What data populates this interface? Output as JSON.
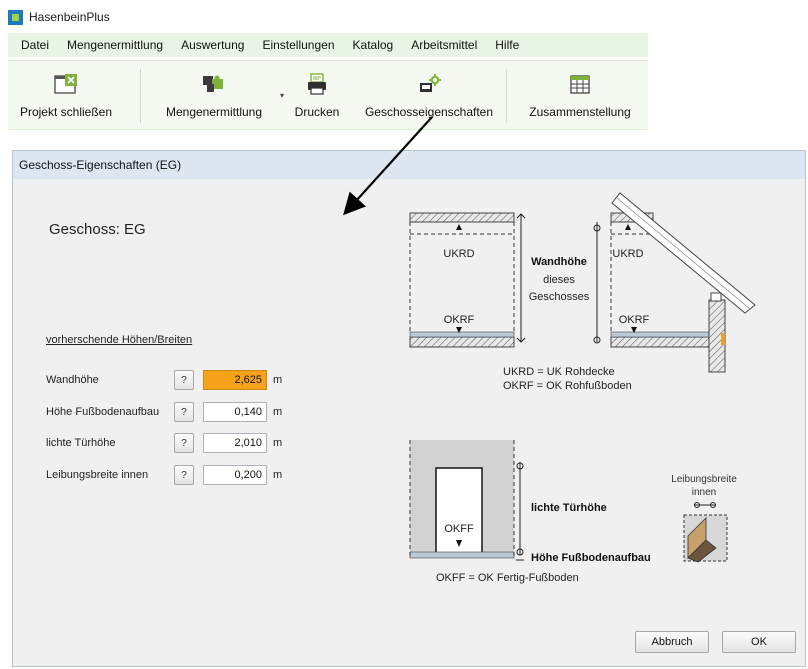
{
  "app": {
    "title": "HasenbeinPlus",
    "menu": [
      "Datei",
      "Mengenermittlung",
      "Auswertung",
      "Einstellungen",
      "Katalog",
      "Arbeitsmittel",
      "Hilfe"
    ],
    "toolbar": {
      "close_project": "Projekt schließen",
      "quantity": "Mengenermittlung",
      "print": "Drucken",
      "floor_properties": "Geschosseigenschaften",
      "summary": "Zusammenstellung"
    }
  },
  "dialog": {
    "title": "Geschoss-Eigenschaften (EG)",
    "floor_heading": "Geschoss: EG",
    "section_link": "vorherschende Höhen/Breiten",
    "help_label": "?",
    "fields": [
      {
        "label": "Wandhöhe",
        "value": "2,625",
        "unit": "m"
      },
      {
        "label": "Höhe Fußbodenaufbau",
        "value": "0,140",
        "unit": "m"
      },
      {
        "label": "lichte Türhöhe",
        "value": "2,010",
        "unit": "m"
      },
      {
        "label": "Leibungsbreite innen",
        "value": "0,200",
        "unit": "m"
      }
    ],
    "cancel_button": "Abbruch",
    "ok_button": "OK"
  },
  "diagram": {
    "ukrd": "UKRD",
    "okrf": "OKRF",
    "wall_height_1": "Wandhöhe",
    "wall_height_2": "dieses",
    "wall_height_3": "Geschosses",
    "legend_ukrd": "UKRD = UK Rohdecke",
    "legend_okrf": "OKRF = OK Rohfußboden",
    "okff": "OKFF",
    "door_height": "lichte Türhöhe",
    "floor_build_height": "Höhe Fußbodenaufbau",
    "legend_okff": "OKFF = OK Fertig-Fußboden",
    "reveal_1": "Leibungsbreite",
    "reveal_2": "innen"
  },
  "colors": {
    "menubar_bg": "#e9f5e4",
    "active_field": "#f7a21b",
    "dialog_title_bg": "#dde7f1",
    "icon_green": "#7fb23a"
  }
}
